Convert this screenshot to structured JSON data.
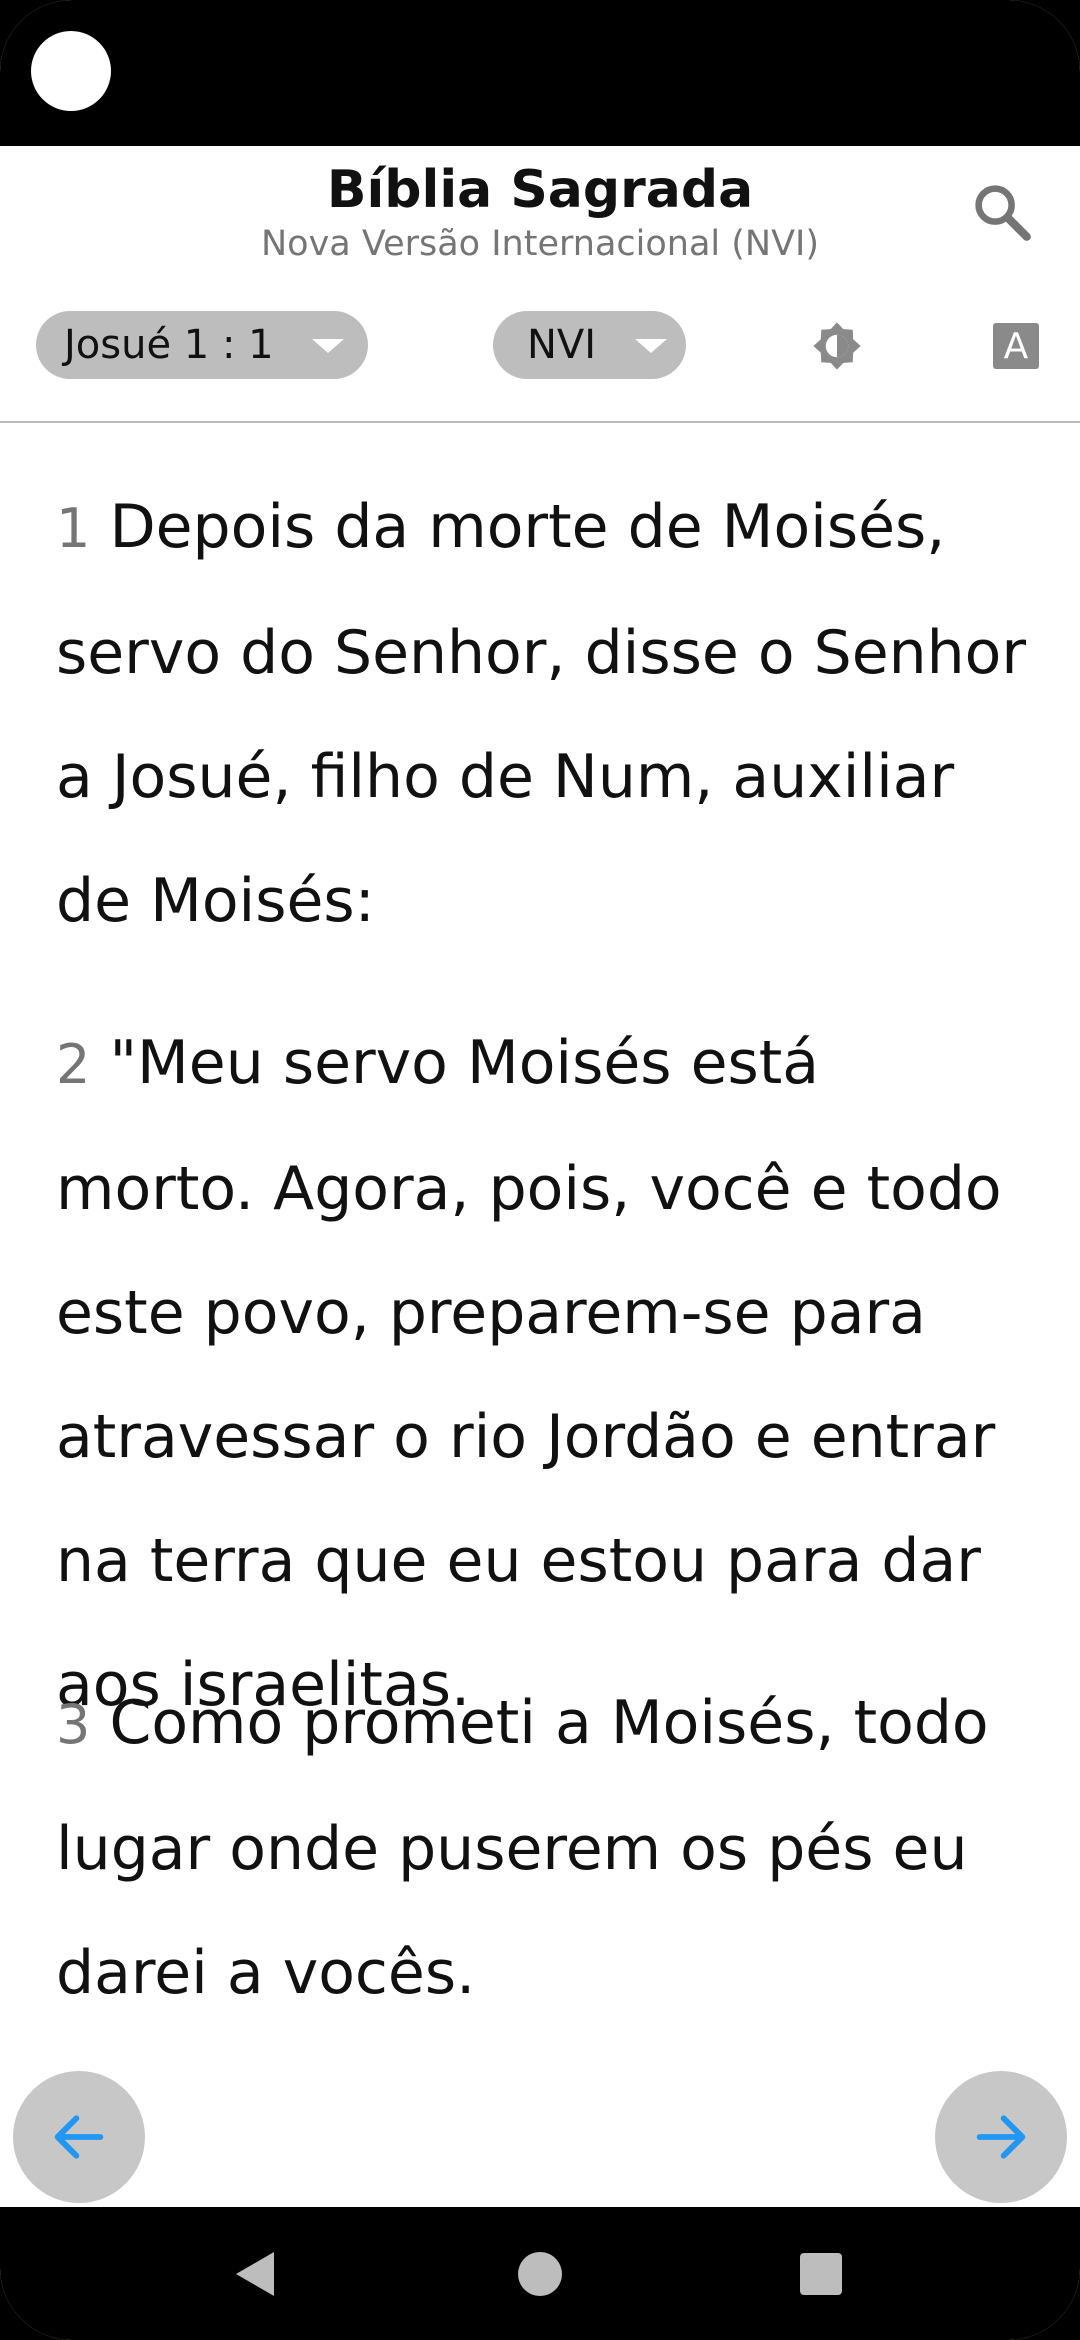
{
  "app": {
    "title": "Bíblia Sagrada",
    "subtitle": "Nova Versão Internacional (NVI)"
  },
  "toolbar": {
    "book_selector": "Josué 1 : 1",
    "version_selector": "NVI",
    "font_button_label": "A"
  },
  "icons": {
    "search": "search-icon",
    "theme": "brightness-icon",
    "font": "font-size-icon",
    "prev": "arrow-left-icon",
    "next": "arrow-right-icon"
  },
  "verses": [
    {
      "num": "1",
      "text": "Depois da morte de Moisés, servo do Senhor, disse o Senhor a Josué, filho de Num, auxiliar de Moisés:"
    },
    {
      "num": "2",
      "text": "\"Meu servo Moisés está morto. Agora, pois, você e todo este povo, preparem-se para atravessar o rio Jordão e entrar na terra que eu estou para dar aos israelitas."
    },
    {
      "num": "3",
      "text": "Como prometi a Moisés, todo lugar onde puserem os pés eu darei a vocês."
    }
  ],
  "colors": {
    "accent": "#2196f3",
    "pill": "#bdbdbd",
    "verse_number": "#757575"
  }
}
